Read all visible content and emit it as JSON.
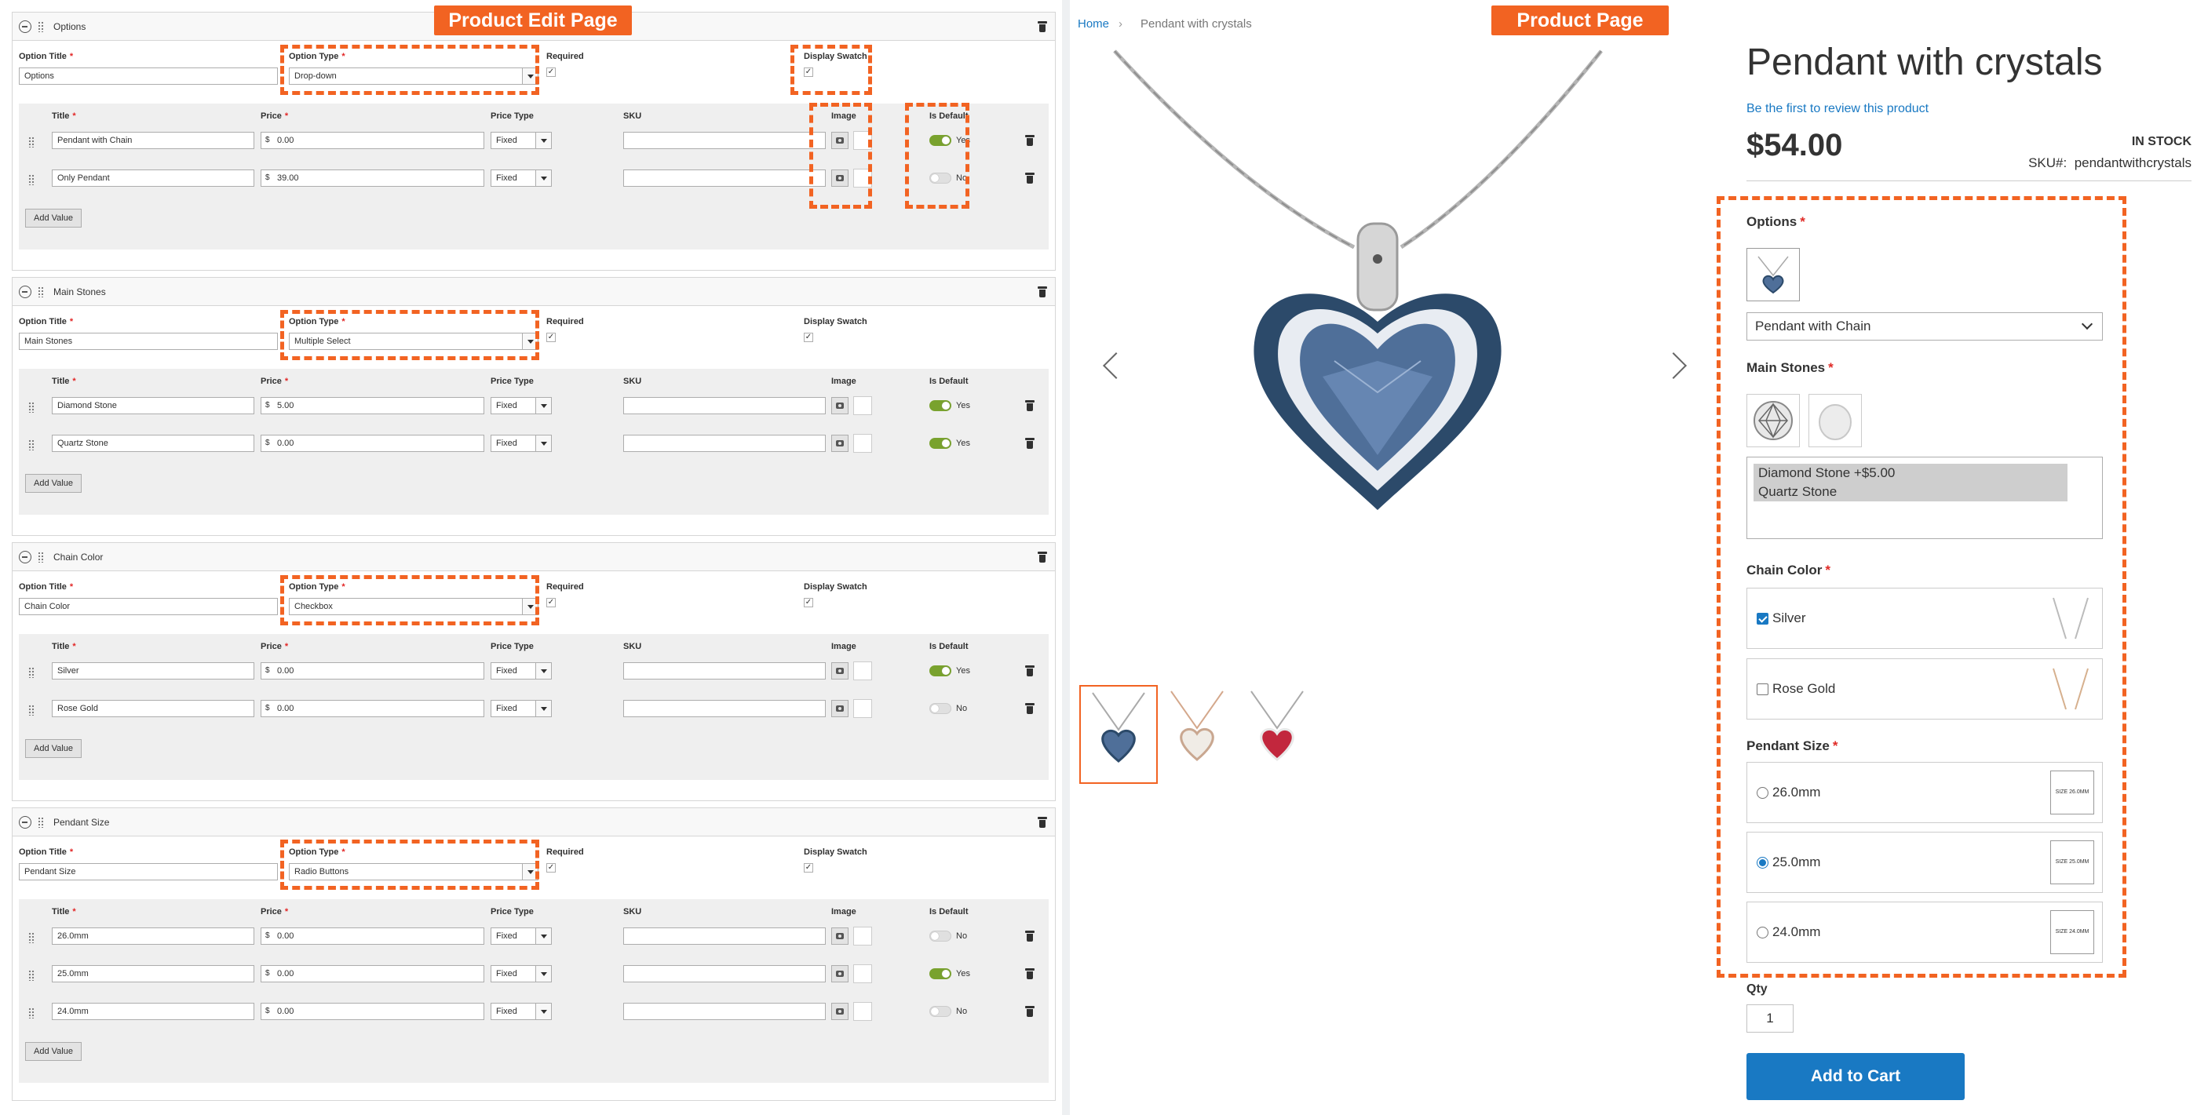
{
  "labels": {
    "edit_page": "Product Edit Page",
    "product_page": "Product Page",
    "option_title": "Option Title",
    "option_type": "Option Type",
    "required": "Required",
    "display_swatch": "Display Swatch",
    "col_title": "Title",
    "col_price": "Price",
    "col_price_type": "Price Type",
    "col_sku": "SKU",
    "col_image": "Image",
    "col_is_default": "Is Default",
    "add_value": "Add Value",
    "currency": "$",
    "asterisk": "*"
  },
  "options": [
    {
      "name": "Options",
      "title": "Options",
      "type": "Drop-down",
      "required": true,
      "display_swatch": true,
      "rows": [
        {
          "title": "Pendant with Chain",
          "price": "0.00",
          "price_type": "Fixed",
          "sku": "",
          "is_default": true,
          "default_text": "Yes"
        },
        {
          "title": "Only Pendant",
          "price": "39.00",
          "price_type": "Fixed",
          "sku": "",
          "is_default": false,
          "default_text": "No"
        }
      ]
    },
    {
      "name": "Main Stones",
      "title": "Main Stones",
      "type": "Multiple Select",
      "required": true,
      "display_swatch": true,
      "rows": [
        {
          "title": "Diamond Stone",
          "price": "5.00",
          "price_type": "Fixed",
          "sku": "",
          "is_default": true,
          "default_text": "Yes"
        },
        {
          "title": "Quartz Stone",
          "price": "0.00",
          "price_type": "Fixed",
          "sku": "",
          "is_default": true,
          "default_text": "Yes"
        }
      ]
    },
    {
      "name": "Chain Color",
      "title": "Chain Color",
      "type": "Checkbox",
      "required": true,
      "display_swatch": true,
      "rows": [
        {
          "title": "Silver",
          "price": "0.00",
          "price_type": "Fixed",
          "sku": "",
          "is_default": true,
          "default_text": "Yes"
        },
        {
          "title": "Rose Gold",
          "price": "0.00",
          "price_type": "Fixed",
          "sku": "",
          "is_default": false,
          "default_text": "No"
        }
      ]
    },
    {
      "name": "Pendant Size",
      "title": "Pendant Size",
      "type": "Radio Buttons",
      "required": true,
      "display_swatch": true,
      "rows": [
        {
          "title": "26.0mm",
          "price": "0.00",
          "price_type": "Fixed",
          "sku": "",
          "is_default": false,
          "default_text": "No"
        },
        {
          "title": "25.0mm",
          "price": "0.00",
          "price_type": "Fixed",
          "sku": "",
          "is_default": true,
          "default_text": "Yes"
        },
        {
          "title": "24.0mm",
          "price": "0.00",
          "price_type": "Fixed",
          "sku": "",
          "is_default": false,
          "default_text": "No"
        }
      ]
    }
  ],
  "product": {
    "breadcrumb": [
      "Home",
      "Pendant with crystals"
    ],
    "name": "Pendant with crystals",
    "review_link": "Be the first to review this product",
    "price": "$54.00",
    "stock": "IN STOCK",
    "sku_label": "SKU#:",
    "sku": "pendantwithcrystals",
    "options_label": "Options",
    "options_selected": "Pendant with Chain",
    "main_stones_label": "Main Stones",
    "main_stones_options": [
      "Diamond Stone +$5.00",
      "Quartz Stone"
    ],
    "chain_color_label": "Chain Color",
    "chain_colors": [
      {
        "label": "Silver",
        "checked": true
      },
      {
        "label": "Rose Gold",
        "checked": false
      }
    ],
    "pendant_size_label": "Pendant Size",
    "sizes": [
      {
        "label": "26.0mm",
        "checked": false,
        "swatch_text": "SIZE 26.0MM"
      },
      {
        "label": "25.0mm",
        "checked": true,
        "swatch_text": "SIZE 25.0MM"
      },
      {
        "label": "24.0mm",
        "checked": false,
        "swatch_text": "SIZE 24.0MM"
      }
    ],
    "qty_label": "Qty",
    "qty": "1",
    "add_to_cart": "Add to Cart"
  },
  "colors": {
    "accent": "#f26322",
    "link": "#1979c3",
    "toggle_on": "#79a22e"
  }
}
